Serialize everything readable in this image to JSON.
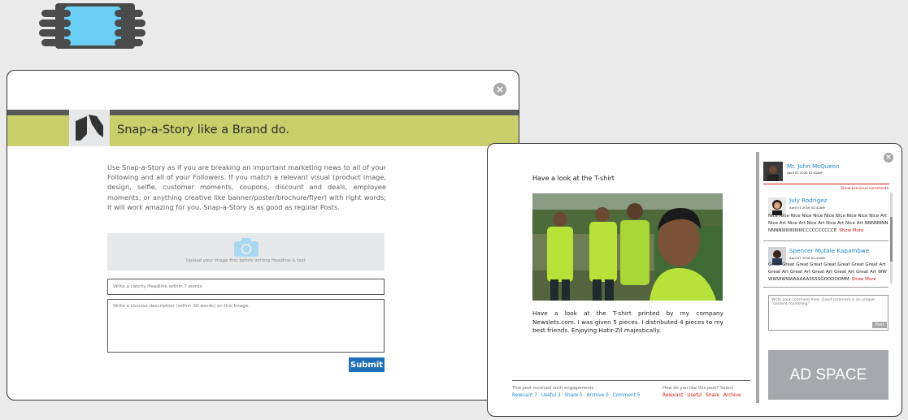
{
  "brand": {
    "title": "Snap-a-Story like a Brand do.",
    "intro": "Use Snap-a-Story as if you are breaking an important marketing news to all of your Following and all of your Followers. If you match a relevant visual (product image, design, selfie, customer moments, coupons, discount and deals, employee moments, or anything creative like banner/poster/brochure/flyer) with right words; it will work amazing for you. Snap-a-Story is as good as regular Posts.",
    "upload_label": "Upload your image first before writing Headline & text",
    "headline_placeholder": "Write a catchy Headline within 7 words.",
    "description_placeholder": "Write a concise description (within 30 words) on this Image.",
    "submit_label": "Submit",
    "close_glyph": "×"
  },
  "post": {
    "title": "Have a look at the T-shirt",
    "body": "Have a look at the T-shirt printed by my company Newslets.com. I was given 5 pieces. I distributed 4 pieces to my best friends. Enjoying Hatir-Zil majestically.",
    "engagement_text": "This post received such engagements",
    "engagement_links": [
      "Relevant 7",
      "Useful 3",
      "Share 5",
      "Archive 0",
      "Comment 5"
    ],
    "like_question": "How do you like this post? Select",
    "like_links": [
      "Relevant",
      "Useful",
      "Share",
      "Archive"
    ],
    "close_glyph": "×"
  },
  "comments": {
    "author": {
      "name": "Mr. John McQueen",
      "date": "April 01 2016 02:42AM"
    },
    "show_previous": "Show previous comments",
    "items": [
      {
        "name": "July Rodrigez",
        "date": "April 01 2016 02:42AM",
        "text": "Nice Nice Nice Nice Nice Nice Nice Nice Nice Nice Art Nice Art Nice Art Nice Art Nice Art Nice Art NNNNNNNNNNNIIIIIIIIIIIIIIIICCCCCCCCCCE",
        "show_more": "Show More"
      },
      {
        "name": "Spencer Mutale Kapambwe",
        "date": "April 01 2016 02:42AM",
        "text": "Great Great Great Great Great Great Great Great Art Great Art Great Art Great Art Great Art Great Art WWWWWWWAAAAAASSSSGOOOOOMM",
        "show_more": "Show More"
      }
    ],
    "input_placeholder": "Write your comment here. Good comment is an unique \"content marketing\".",
    "post_label": "Post"
  },
  "ad": {
    "label": "AD SPACE"
  },
  "colors": {
    "accent_green": "#c9cf6b",
    "link_blue": "#1e88c8",
    "alert_red": "#d01818",
    "submit_blue": "#1e6fb5"
  }
}
